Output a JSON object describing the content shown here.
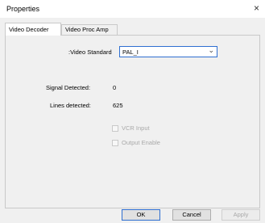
{
  "window": {
    "title": "Properties",
    "close_glyph": "×"
  },
  "tabs": [
    {
      "label": "Video Decoder",
      "active": true
    },
    {
      "label": "Video Proc Amp",
      "active": false
    }
  ],
  "decoder": {
    "video_standard_label": ":Video Standard",
    "video_standard_value": "PAL_I",
    "signal_detected_label": "Signal Detected:",
    "signal_detected_value": "0",
    "lines_detected_label": "Lines detected:",
    "lines_detected_value": "625",
    "vcr_input_label": "VCR Input",
    "vcr_input_checked": false,
    "output_enable_label": "Output Enable",
    "output_enable_checked": false
  },
  "buttons": {
    "ok": "OK",
    "cancel": "Cancel",
    "apply": "Apply"
  }
}
